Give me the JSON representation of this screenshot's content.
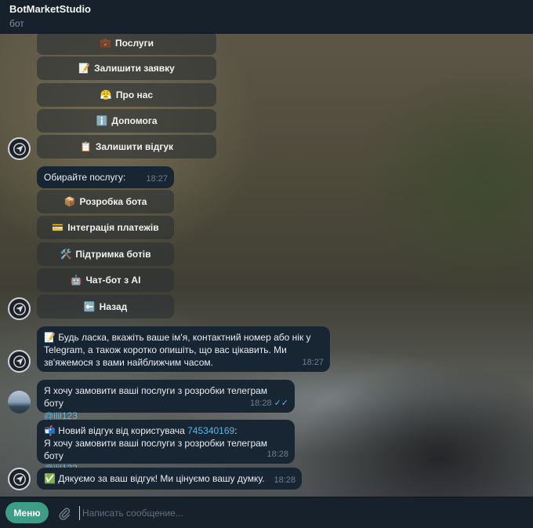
{
  "header": {
    "title": "BotMarketStudio",
    "subtitle": "бот"
  },
  "keyboard1": [
    {
      "emoji": "💼",
      "label": "Послуги"
    },
    {
      "emoji": "📝",
      "label": "Залишити заявку"
    },
    {
      "emoji": "😤",
      "label": "Про нас"
    },
    {
      "emoji": "ℹ️",
      "label": "Допомога"
    },
    {
      "emoji": "📋",
      "label": "Залишити відгук"
    }
  ],
  "msg_choose": {
    "text": "Обирайте послугу:",
    "time": "18:27"
  },
  "keyboard2": [
    {
      "emoji": "📦",
      "label": "Розробка бота"
    },
    {
      "emoji": "💳",
      "label": "Інтеграція платежів"
    },
    {
      "emoji": "🛠️",
      "label": "Підтримка ботів"
    },
    {
      "emoji": "🤖",
      "label": "Чат-бот з AI"
    },
    {
      "emoji": "⬅️",
      "label": "Назад"
    }
  ],
  "msg_request": {
    "emoji": "📝",
    "line1": "Будь ласка, вкажіть ваше ім'я, контактний номер або нік у",
    "line2": "Telegram, а також коротко опишіть, що вас цікавить. Ми",
    "line3": "зв'яжемося з вами найближчим часом.",
    "time": "18:27"
  },
  "msg_user": {
    "text": "Я хочу замовити ваші послуги з розробки телеграм боту",
    "handle": "@ilil123",
    "time": "18:28",
    "ticks": "✓✓"
  },
  "msg_review": {
    "emoji": "📬",
    "prefix": "Новий відгук від користувача",
    "user_id": "745340169",
    "suffix": ":",
    "text": "Я хочу замовити ваші послуги з розробки телеграм боту",
    "handle": "@ilil123",
    "time": "18:28"
  },
  "msg_thanks": {
    "emoji": "✅",
    "text": "Дякуємо за ваш відгук! Ми цінуємо вашу думку.",
    "time": "18:28"
  },
  "composer": {
    "menu_label": "Меню",
    "placeholder": "Написать сообщение..."
  },
  "colors": {
    "accent": "#3e9d86",
    "link": "#5fb6e8",
    "bubble": "#182533",
    "panel": "#17212b"
  }
}
